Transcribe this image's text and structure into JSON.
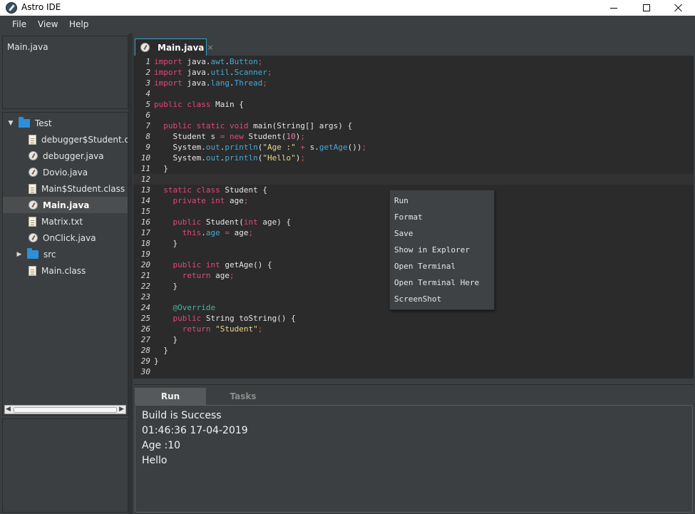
{
  "window": {
    "title": "Astro IDE"
  },
  "menu": [
    "File",
    "View",
    "Help"
  ],
  "open_files": [
    "Main.java"
  ],
  "tree": [
    {
      "label": "Test",
      "type": "folder",
      "expanded": true,
      "depth": 0
    },
    {
      "label": "debugger$Student.cl...",
      "type": "file",
      "depth": 1
    },
    {
      "label": "debugger.java",
      "type": "java",
      "depth": 1
    },
    {
      "label": "Dovio.java",
      "type": "java",
      "depth": 1
    },
    {
      "label": "Main$Student.class",
      "type": "file",
      "depth": 1
    },
    {
      "label": "Main.java",
      "type": "java",
      "depth": 1,
      "selected": true
    },
    {
      "label": "Matrix.txt",
      "type": "file",
      "depth": 1
    },
    {
      "label": "OnClick.java",
      "type": "java",
      "depth": 1
    },
    {
      "label": "src",
      "type": "folder",
      "expanded": false,
      "depth": 1
    },
    {
      "label": "Main.class",
      "type": "file",
      "depth": 1
    }
  ],
  "editor": {
    "tab_label": "Main.java",
    "tab_close": "×",
    "current_line": 12,
    "lines": [
      [
        [
          "kw",
          "import"
        ],
        [
          "code",
          " java."
        ],
        [
          "fld",
          "awt"
        ],
        [
          "code",
          "."
        ],
        [
          "fld",
          "Button"
        ],
        [
          "semi",
          ";"
        ]
      ],
      [
        [
          "kw",
          "import"
        ],
        [
          "code",
          " java."
        ],
        [
          "fld",
          "util"
        ],
        [
          "code",
          "."
        ],
        [
          "fld",
          "Scanner"
        ],
        [
          "semi",
          ";"
        ]
      ],
      [
        [
          "kw",
          "import"
        ],
        [
          "code",
          " java."
        ],
        [
          "fld",
          "lang"
        ],
        [
          "code",
          "."
        ],
        [
          "fld",
          "Thread"
        ],
        [
          "semi",
          ";"
        ]
      ],
      [],
      [
        [
          "kw",
          "public class"
        ],
        [
          "code",
          " Main {"
        ]
      ],
      [],
      [
        [
          "code",
          "  "
        ],
        [
          "kw",
          "public static void"
        ],
        [
          "code",
          " main(String[] args) {"
        ]
      ],
      [
        [
          "code",
          "    Student s "
        ],
        [
          "kw",
          "="
        ],
        [
          "code",
          " "
        ],
        [
          "kw",
          "new"
        ],
        [
          "code",
          " Student("
        ],
        [
          "num",
          "10"
        ],
        [
          "code",
          ")"
        ],
        [
          "semi",
          ";"
        ]
      ],
      [
        [
          "code",
          "    System."
        ],
        [
          "fld",
          "out"
        ],
        [
          "code",
          "."
        ],
        [
          "fld",
          "println"
        ],
        [
          "code",
          "("
        ],
        [
          "str",
          "\"Age :\""
        ],
        [
          "code",
          " "
        ],
        [
          "kw",
          "+"
        ],
        [
          "code",
          " s."
        ],
        [
          "fld",
          "getAge"
        ],
        [
          "code",
          "())"
        ],
        [
          "semi",
          ";"
        ]
      ],
      [
        [
          "code",
          "    System."
        ],
        [
          "fld",
          "out"
        ],
        [
          "code",
          "."
        ],
        [
          "fld",
          "println"
        ],
        [
          "code",
          "("
        ],
        [
          "str",
          "\"Hello\""
        ],
        [
          "code",
          ")"
        ],
        [
          "semi",
          ";"
        ]
      ],
      [
        [
          "code",
          "  }"
        ]
      ],
      [],
      [
        [
          "code",
          "  "
        ],
        [
          "kw",
          "static class"
        ],
        [
          "code",
          " Student {"
        ]
      ],
      [
        [
          "code",
          "    "
        ],
        [
          "kw",
          "private int"
        ],
        [
          "code",
          " age"
        ],
        [
          "semi",
          ";"
        ]
      ],
      [],
      [
        [
          "code",
          "    "
        ],
        [
          "kw",
          "public"
        ],
        [
          "code",
          " Student("
        ],
        [
          "kw",
          "int"
        ],
        [
          "code",
          " age) {"
        ]
      ],
      [
        [
          "code",
          "      "
        ],
        [
          "kw",
          "this"
        ],
        [
          "code",
          "."
        ],
        [
          "fld",
          "age"
        ],
        [
          "code",
          " "
        ],
        [
          "kw",
          "="
        ],
        [
          "code",
          " age"
        ],
        [
          "semi",
          ";"
        ]
      ],
      [
        [
          "code",
          "    }"
        ]
      ],
      [],
      [
        [
          "code",
          "    "
        ],
        [
          "kw",
          "public int"
        ],
        [
          "code",
          " getAge() {"
        ]
      ],
      [
        [
          "code",
          "      "
        ],
        [
          "kw",
          "return"
        ],
        [
          "code",
          " age"
        ],
        [
          "semi",
          ";"
        ]
      ],
      [
        [
          "code",
          "    }"
        ]
      ],
      [],
      [
        [
          "code",
          "    "
        ],
        [
          "ann",
          "@Override"
        ]
      ],
      [
        [
          "code",
          "    "
        ],
        [
          "kw",
          "public"
        ],
        [
          "code",
          " String toString() {"
        ]
      ],
      [
        [
          "code",
          "      "
        ],
        [
          "kw",
          "return"
        ],
        [
          "code",
          " "
        ],
        [
          "str",
          "\"Student\""
        ],
        [
          "semi",
          ";"
        ]
      ],
      [
        [
          "code",
          "    }"
        ]
      ],
      [
        [
          "code",
          "  }"
        ]
      ],
      [
        [
          "code",
          "}"
        ]
      ],
      []
    ]
  },
  "context_menu": [
    "Run",
    "Format",
    "Save",
    "Show in Explorer",
    "Open Terminal",
    "Open Terminal Here",
    "ScreenShot"
  ],
  "bottom_tabs": {
    "run": "Run",
    "tasks": "Tasks"
  },
  "console": [
    "Build is Success",
    "01:46:36 17-04-2019",
    "Age :10",
    "Hello"
  ],
  "colors": {
    "keyword": "#e8457a",
    "field": "#47a8d6",
    "string": "#ecd783",
    "number": "#ea7fa8",
    "annotation": "#44b5a2",
    "accent": "#2aa0c0",
    "folder": "#2d8fd8"
  }
}
